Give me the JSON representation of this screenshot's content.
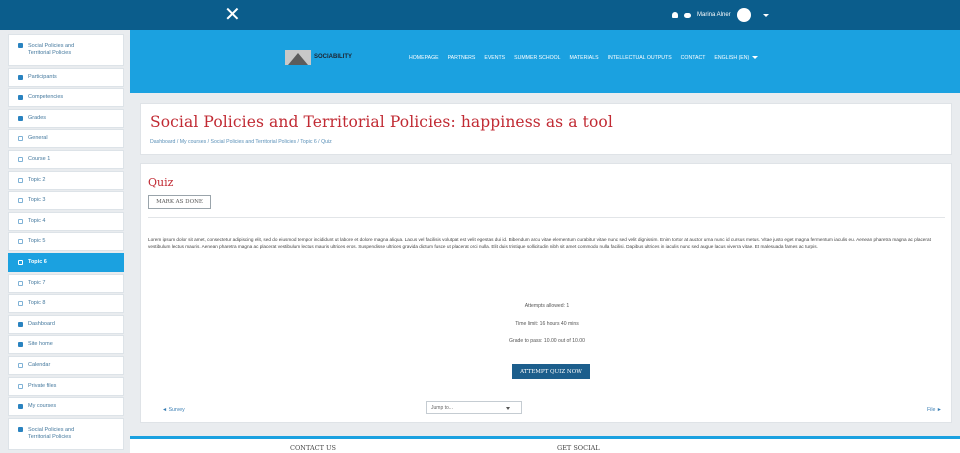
{
  "topbar": {
    "close_glyph": "✕",
    "user_name": "Marina Alner",
    "icons": [
      "bell-icon",
      "chat-icon",
      "avatar",
      "chevron-down-icon"
    ]
  },
  "header": {
    "logo_text": "SOCIABILITY",
    "nav": [
      "HOMEPAGE",
      "PARTNERS",
      "EVENTS",
      "SUMMER SCHOOL",
      "MATERIALS",
      "INTELLECTUAL OUTPUTS",
      "CONTACT",
      "ENGLISH (EN)"
    ],
    "accent_color": "#1ba1e0"
  },
  "sidebar": {
    "items": [
      {
        "label": "Social Policies and Territorial Policies",
        "icon": "hat-icon"
      },
      {
        "label": "Participants",
        "icon": "users-icon"
      },
      {
        "label": "Competencies",
        "icon": "check-icon"
      },
      {
        "label": "Grades",
        "icon": "table-icon"
      },
      {
        "label": "General",
        "icon": "folder-icon"
      },
      {
        "label": "Course 1",
        "icon": "folder-icon"
      },
      {
        "label": "Topic 2",
        "icon": "folder-icon"
      },
      {
        "label": "Topic 3",
        "icon": "folder-icon"
      },
      {
        "label": "Topic 4",
        "icon": "folder-icon"
      },
      {
        "label": "Topic 5",
        "icon": "folder-icon"
      },
      {
        "label": "Topic 6",
        "icon": "folder-icon",
        "active": true
      },
      {
        "label": "Topic 7",
        "icon": "folder-icon"
      },
      {
        "label": "Topic 8",
        "icon": "folder-icon"
      },
      {
        "label": "Dashboard",
        "icon": "dashboard-icon"
      },
      {
        "label": "Site home",
        "icon": "home-icon"
      },
      {
        "label": "Calendar",
        "icon": "calendar-icon"
      },
      {
        "label": "Private files",
        "icon": "file-icon"
      },
      {
        "label": "My courses",
        "icon": "hat-icon"
      },
      {
        "label": "Social Policies and Territorial Policies",
        "icon": "hat-icon"
      }
    ]
  },
  "page": {
    "title": "Social Policies and Territorial Policies: happiness as a tool",
    "breadcrumb": "Dashboard  /  My courses  /  Social Policies and Territorial Policies  /  Topic 6  /  Quiz"
  },
  "quiz": {
    "heading": "Quiz",
    "mark_done_label": "MARK AS DONE",
    "description": "Lorem ipsum dolor sit amet, consectetur adipiscing elit, sed do eiusmod tempor incididunt ut labore et dolore magna aliqua. Lacus vel facilisis volutpat est velit egestas dui id. Bibendum arcu vitae elementum curabitur vitae nunc sed velit dignissim. Enim tortor at auctor urna nunc id cursus metus. Vitae justo eget magna fermentum iaculis eu. Aenean pharetra magna ac placerat vestibulum lectus mauris. Aenean pharetra magna ac placerat vestibulum lectus mauris ultrices eros. Suspendisse ultrices gravida dictum fusce ut placerat orci nulla. Elit duis tristique sollicitudin nibh sit amet commodo nulla facilisi. Dapibus ultrices in iaculis nunc sed augue lacus viverra vitae. Et malesuada fames ac turpis.",
    "attempts_allowed": "Attempts allowed: 1",
    "time_limit": "Time limit: 16 hours 40 mins",
    "grade_to_pass": "Grade to pass: 10.00 out of 10.00",
    "attempt_button": "ATTEMPT QUIZ NOW",
    "prev_link": "◄ Survey",
    "jump_placeholder": "Jump to...",
    "next_link": "File ►"
  },
  "footer": {
    "contact": "CONTACT US",
    "social": "GET SOCIAL"
  }
}
